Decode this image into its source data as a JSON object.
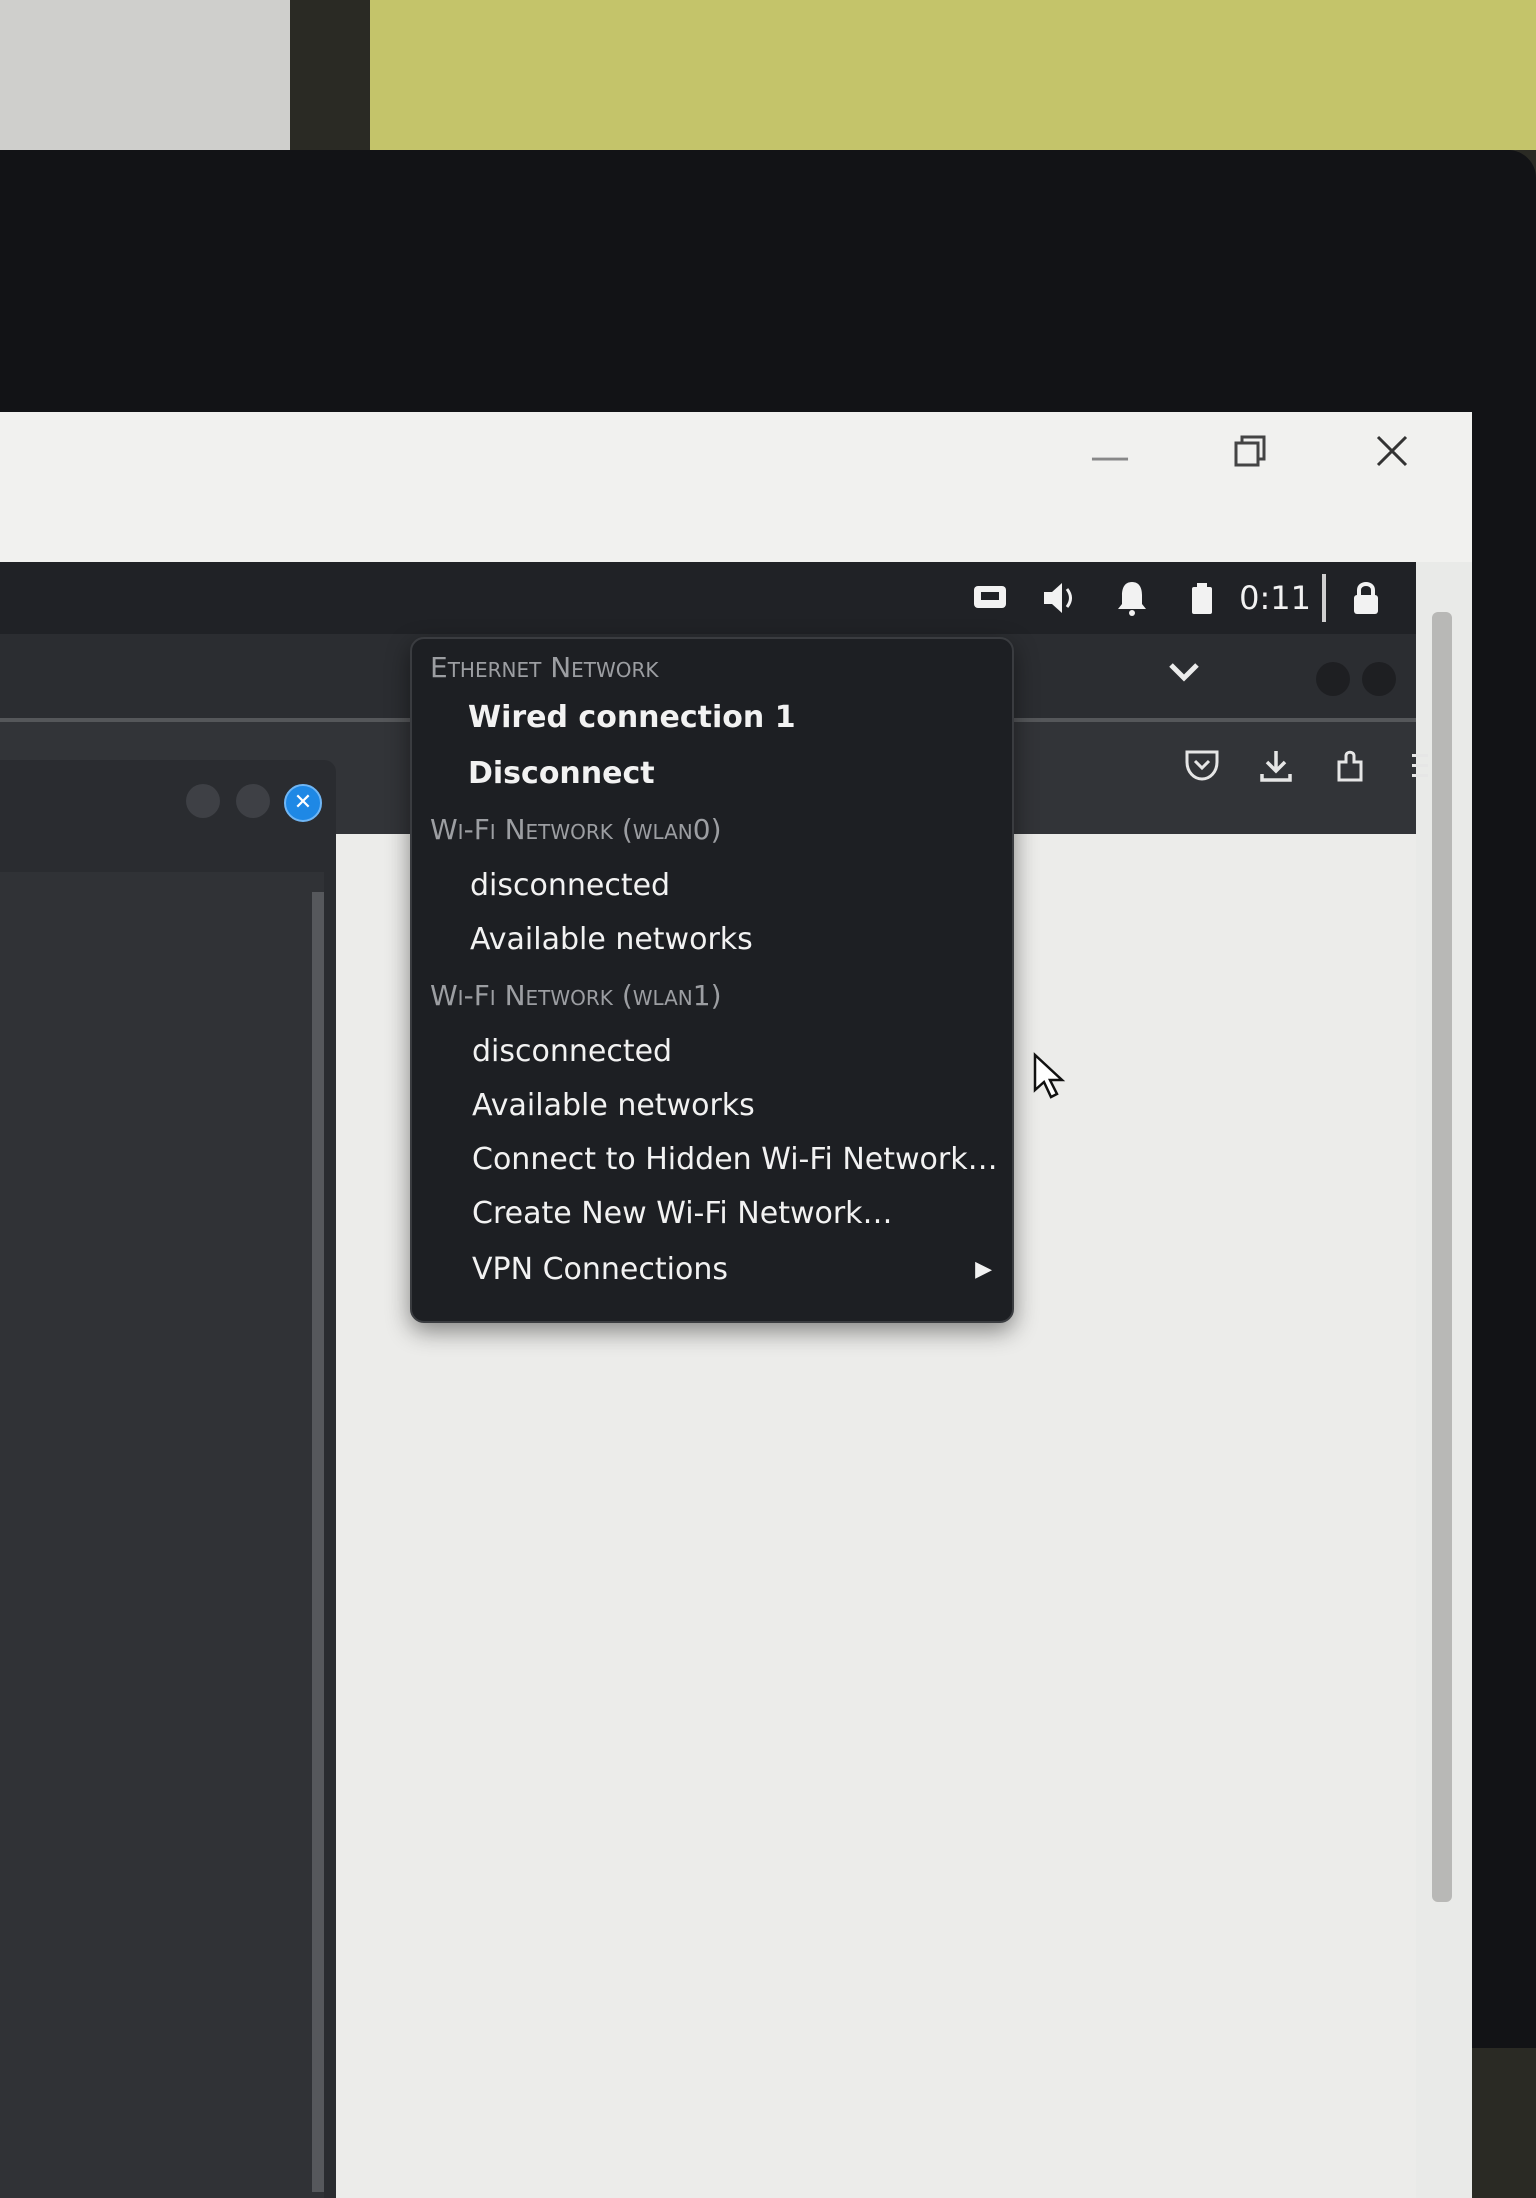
{
  "top_panel": {
    "clock": "0:11"
  },
  "network_menu": {
    "ethernet_header": "Ethernet Network",
    "wired_connection": "Wired connection 1",
    "disconnect": "Disconnect",
    "wifi_wlan0_header": "Wi-Fi Network (wlan0)",
    "wlan0_status": "disconnected",
    "wlan0_available": "Available networks",
    "wifi_wlan1_header": "Wi-Fi Network (wlan1)",
    "wlan1_status": "disconnected",
    "wlan1_available": "Available networks",
    "connect_hidden": "Connect to Hidden Wi-Fi Network…",
    "create_new": "Create New Wi-Fi Network…",
    "vpn": "VPN Connections"
  },
  "colors": {
    "panel": "#202226",
    "menu_bg": "#1d1f23",
    "accent_close": "#1e88e5"
  },
  "icons": {
    "tray": [
      "network-wired-icon",
      "volume-icon",
      "notification-bell-icon",
      "battery-icon",
      "lock-icon"
    ],
    "toolbar": [
      "pocket-icon",
      "download-icon",
      "extension-icon",
      "menu-icon"
    ]
  }
}
